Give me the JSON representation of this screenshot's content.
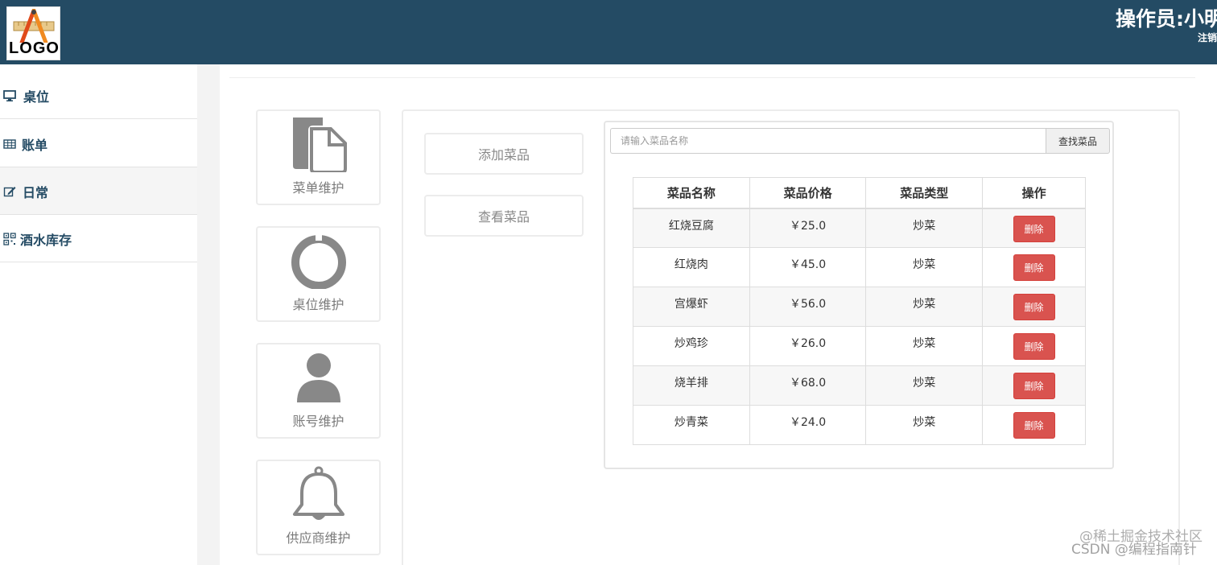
{
  "header": {
    "logo_text": "LOGO",
    "operator_label": "操作员:小明",
    "logout_label": "注销"
  },
  "sidebar": {
    "items": [
      {
        "label": "桌位",
        "icon": "monitor-icon"
      },
      {
        "label": "账单",
        "icon": "table-icon"
      },
      {
        "label": "日常",
        "icon": "edit-icon"
      },
      {
        "label": "酒水库存",
        "icon": "qrcode-icon"
      }
    ]
  },
  "tiles": [
    {
      "label": "菜单维护",
      "icon": "file-icon"
    },
    {
      "label": "桌位维护",
      "icon": "ring-icon"
    },
    {
      "label": "账号维护",
      "icon": "user-icon"
    },
    {
      "label": "供应商维护",
      "icon": "bell-icon"
    }
  ],
  "actions": {
    "add_dish": "添加菜品",
    "view_dish": "查看菜品"
  },
  "search": {
    "placeholder": "请输入菜品名称",
    "value": "",
    "button_label": "查找菜品"
  },
  "table": {
    "headers": [
      "菜品名称",
      "菜品价格",
      "菜品类型",
      "操作"
    ],
    "rows": [
      {
        "name": "红烧豆腐",
        "price": "￥25.0",
        "type": "炒菜",
        "action": "删除"
      },
      {
        "name": "红烧肉",
        "price": "￥45.0",
        "type": "炒菜",
        "action": "删除"
      },
      {
        "name": "宫爆虾",
        "price": "￥56.0",
        "type": "炒菜",
        "action": "删除"
      },
      {
        "name": "炒鸡珍",
        "price": "￥26.0",
        "type": "炒菜",
        "action": "删除"
      },
      {
        "name": "烧羊排",
        "price": "￥68.0",
        "type": "炒菜",
        "action": "删除"
      },
      {
        "name": "炒青菜",
        "price": "￥24.0",
        "type": "炒菜",
        "action": "删除"
      }
    ]
  },
  "watermark": {
    "line1": "@稀土掘金技术社区",
    "line2": "CSDN @编程指南针"
  },
  "colors": {
    "header_bg": "#244b64",
    "sidebar_text": "#244b64",
    "danger": "#d9534f"
  }
}
